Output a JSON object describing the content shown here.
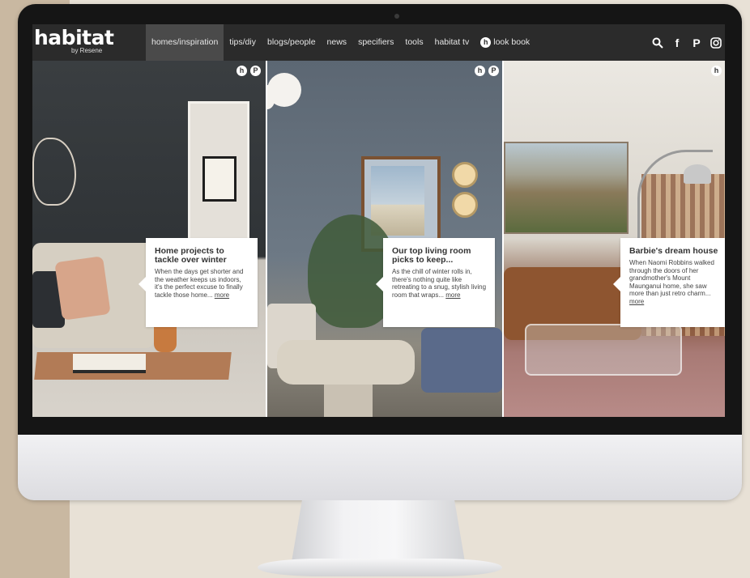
{
  "nav": {
    "logo": "habitat",
    "logo_sub": "by Resene",
    "items": [
      {
        "label": "homes/inspiration",
        "active": true
      },
      {
        "label": "tips/diy"
      },
      {
        "label": "blogs/people"
      },
      {
        "label": "news"
      },
      {
        "label": "specifiers"
      },
      {
        "label": "tools"
      },
      {
        "label": "habitat tv"
      },
      {
        "label": "look book",
        "icon": "habitat-h-icon"
      }
    ],
    "social_icons": [
      "search-icon",
      "facebook-icon",
      "pinterest-icon",
      "instagram-icon"
    ],
    "social_glyphs": {
      "facebook": "f",
      "pinterest": "P",
      "badge": "h"
    }
  },
  "cards": [
    {
      "title": "Home projects to tackle over winter",
      "text": "When the days get shorter and the weather keeps us indoors, it's the perfect excuse to finally tackle those home...",
      "more": "more"
    },
    {
      "title": "Our top living room picks to keep...",
      "text": "As the chill of winter rolls in, there's nothing quite like retreating to a snug, stylish living room that wraps...",
      "more": "more"
    },
    {
      "title": "Barbie's dream house",
      "text": "When Naomi Robbins walked through the doors of her grandmother's Mount Maunganui home, she saw more than just retro charm...",
      "more": "more"
    }
  ],
  "colors": {
    "navbar_bg": "#2b2b2b",
    "active_nav_bg": "#4a4a4a",
    "page_bg": "#e8e1d6",
    "page_strip": "#c9b8a1"
  }
}
